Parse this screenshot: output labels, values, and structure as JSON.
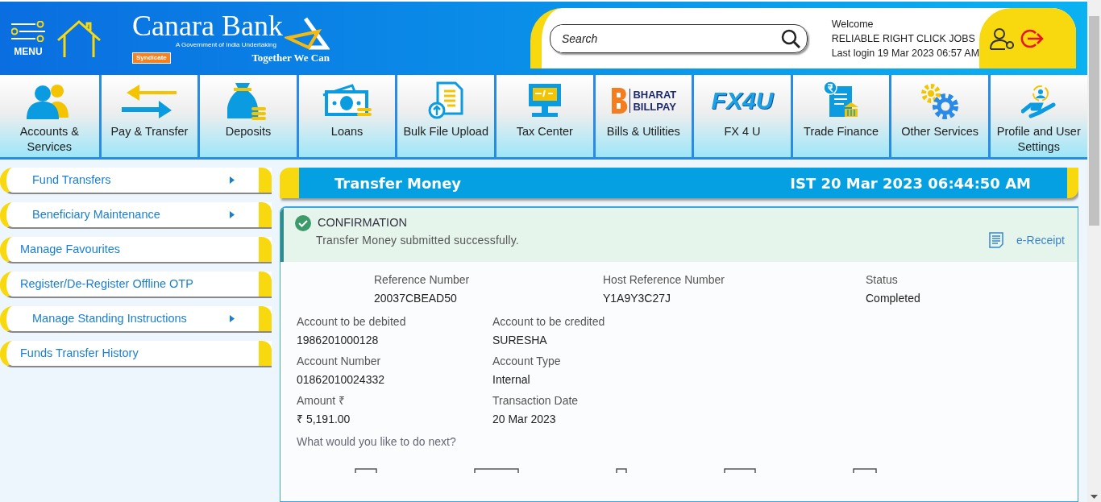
{
  "header": {
    "menu_label": "MENU",
    "bank_name": "Canara Bank",
    "tagline": "A Government of India Undertaking",
    "partner_logo_text": "Syndicate",
    "slogan": "Together We Can",
    "search": {
      "placeholder": "Search"
    },
    "welcome": "Welcome",
    "user_name": "RELIABLE RIGHT CLICK JOBS",
    "last_login": "Last login 19 Mar 2023 06:57 AM"
  },
  "nav": [
    {
      "label": "Accounts & Services"
    },
    {
      "label": "Pay & Transfer"
    },
    {
      "label": "Deposits"
    },
    {
      "label": "Loans"
    },
    {
      "label": "Bulk File Upload"
    },
    {
      "label": "Tax Center"
    },
    {
      "label": "Bills & Utilities",
      "logo_lines": [
        "BHARAT",
        "BILLPAY"
      ]
    },
    {
      "label": "FX 4 U",
      "logo_lines": [
        "FX4U"
      ]
    },
    {
      "label": "Trade Finance"
    },
    {
      "label": "Other Services"
    },
    {
      "label": "Profile and User Settings"
    }
  ],
  "sidebar": {
    "items": [
      {
        "label": "Fund Transfers",
        "has_submenu": true
      },
      {
        "label": "Beneficiary Maintenance",
        "has_submenu": true
      },
      {
        "label": "Manage Favourites",
        "has_submenu": false
      },
      {
        "label": "Register/De-Register Offline OTP",
        "has_submenu": false
      },
      {
        "label": "Manage Standing Instructions",
        "has_submenu": true
      },
      {
        "label": "Funds Transfer History",
        "has_submenu": false
      }
    ]
  },
  "panel": {
    "title": "Transfer Money",
    "timestamp": "IST 20 Mar 2023 06:44:50 AM",
    "alert": {
      "title": "CONFIRMATION",
      "message": "Transfer Money submitted successfully.",
      "link": "e-Receipt"
    },
    "summary": [
      {
        "label": "Reference Number",
        "value": "20037CBEAD50"
      },
      {
        "label": "Host Reference Number",
        "value": "Y1A9Y3C27J"
      },
      {
        "label": "Status",
        "value": "Completed"
      }
    ],
    "fields": [
      {
        "label": "Account to be debited",
        "value": "1986201000128"
      },
      {
        "label": "Account to be credited",
        "value": "SURESHA"
      },
      {
        "label": "Account Number",
        "value": "01862010024332"
      },
      {
        "label": "Account Type",
        "value": "Internal"
      },
      {
        "label": "Amount ₹",
        "value": "₹ 5,191.00"
      },
      {
        "label": "Transaction Date",
        "value": "20 Mar 2023"
      }
    ],
    "next_prompt": "What would you like to do next?"
  }
}
